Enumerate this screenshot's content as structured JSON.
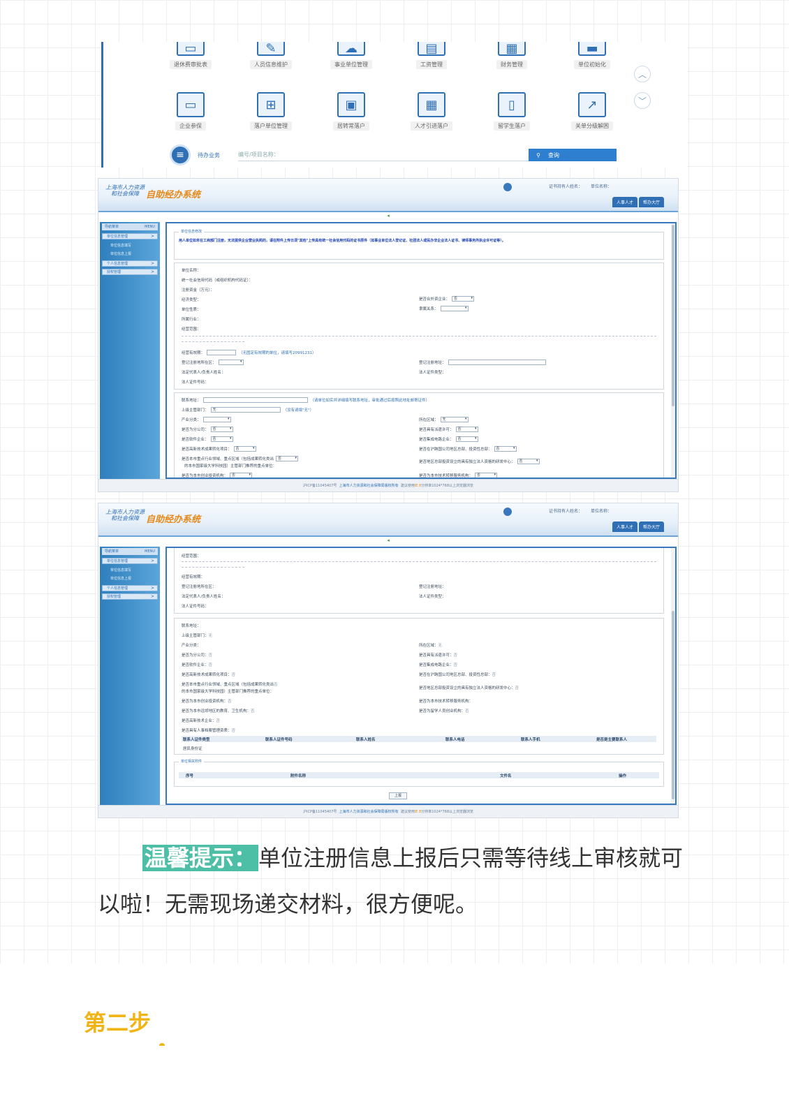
{
  "portal": {
    "icons_row1": [
      "退休费审批表",
      "人员信息维护",
      "事业单位管理",
      "工资管理",
      "财务管理",
      "单位初始化"
    ],
    "icons_row2": [
      "企业参保",
      "落户单位管理",
      "居转常落户",
      "人才引进落户",
      "留学生落户",
      "关单分级解困"
    ],
    "todo_label": "待办业务",
    "todo_placeholder": "编号/项目名称：",
    "search_label": "查询"
  },
  "system": {
    "logo_small_1": "上海市人力资源",
    "logo_small_2": "和社会保障",
    "logo_big": "自助经办系统",
    "header_info_1": "证书持有人姓名：",
    "header_info_2": "单位名称：",
    "tab_1": "人事人才",
    "tab_2": "帮办大厅",
    "sidebar_title": "导航菜单",
    "sidebar_menu": "MENU",
    "side_items": [
      "单位信息管理",
      "个人信息管理",
      "授权管理"
    ],
    "side_subs": [
      "单位信息填写",
      "单位信息上报"
    ],
    "footer_icp": "沪ICP备11045407号",
    "footer_org": "上海市人力资源和社会保障局版权所有",
    "footer_tip_1": "建议使用",
    "footer_tip_2": "IE 8",
    "footer_tip_3": "分辨率1024*768以上浏览器浏览"
  },
  "form1": {
    "section_title": "单位信息修改",
    "warning": "用人单位如未在工商部门注册，无法提供企业营业执照的，请在附件上传日须\"其他\"上传具有统一社会信用代码的证书原件（如事业单位法人登记证、社团法人或民办非企业法人证书、律师事务所执业许可证等）。",
    "f_name": "单位名称：",
    "f_credit": "统一社会信用代码（或组织机构代码证）：",
    "f_capital": "注册资金（万元）：",
    "f_economy": "经济类型：",
    "f_foreign": "是否合外资企业：",
    "f_foreign_val": "否",
    "f_nature": "单位性质：",
    "f_affiliation": "隶属关系：",
    "f_industry": "所属行业：",
    "f_scope": "经营范围：",
    "f_term": "经营有效期：",
    "f_term_hint": "（无固定有效期的单位，请填写20991231）",
    "f_reg_district": "登记注册地所在区：",
    "f_reg_address": "登记注册地址：",
    "f_legal_name": "法定代表人/负责人姓名：",
    "f_legal_type": "法人证件类型：",
    "f_legal_no": "法人证件号码：",
    "f_contact": "联系地址：",
    "f_contact_hint": "（请单位如实并详细填写联系地址，审批通过后按照此地址邮寄证件）",
    "f_dept": "上级主管部门：",
    "f_dept_val": "无",
    "f_dept_hint": "（没有请填\"无\"）",
    "f_industry_cat": "产业分类：",
    "f_area": "所在区域：",
    "f_area_val": "无",
    "f_branch": "是否为分公司：",
    "f_license": "是否具有派遣许可：",
    "f_software": "是否软件企业：",
    "f_ic": "是否集成电路企业：",
    "f_hightech": "是否高新技术成果转化项目：",
    "f_hq": "是否在沪跨国公司地区总部、投资性总部：",
    "f_key": "是否本市重点行业领域、重点区域（包括成果转化类出",
    "f_key2": "的本市国家级大学科技园）主管部门推荐的重点单位：",
    "f_rd": "是否地区总部投资设立的具有独立法人资格的研发中心：",
    "f_venture": "是否为本市创业投资机构：",
    "f_tech_service": "是否为本市技术转移服务机构：",
    "no": "否"
  },
  "form2": {
    "f_school": "是否为本市远郊地区的教育、卫生机构：",
    "f_overseas": "是否为留学人员创业机构：",
    "f_hightech_ent": "是否高新技术企业：",
    "f_hr": "是否具有人事档案管理资质：",
    "contacts_headers": [
      "联系人证件类型",
      "联系人证件号码",
      "联系人姓名",
      "联系人电话",
      "联系人手机",
      "是否是主要联系人"
    ],
    "contacts_row": "居民身份证",
    "attach_title": "单位相关附件",
    "attach_headers": [
      "序号",
      "附件名称",
      "文件名",
      "操作"
    ],
    "upload": "上报"
  },
  "tip": {
    "badge": "温馨提示：",
    "text": "单位注册信息上报后只需等待线上审核就可以啦！无需现场递交材料，很方便呢。"
  },
  "step": {
    "title": "第二步"
  }
}
